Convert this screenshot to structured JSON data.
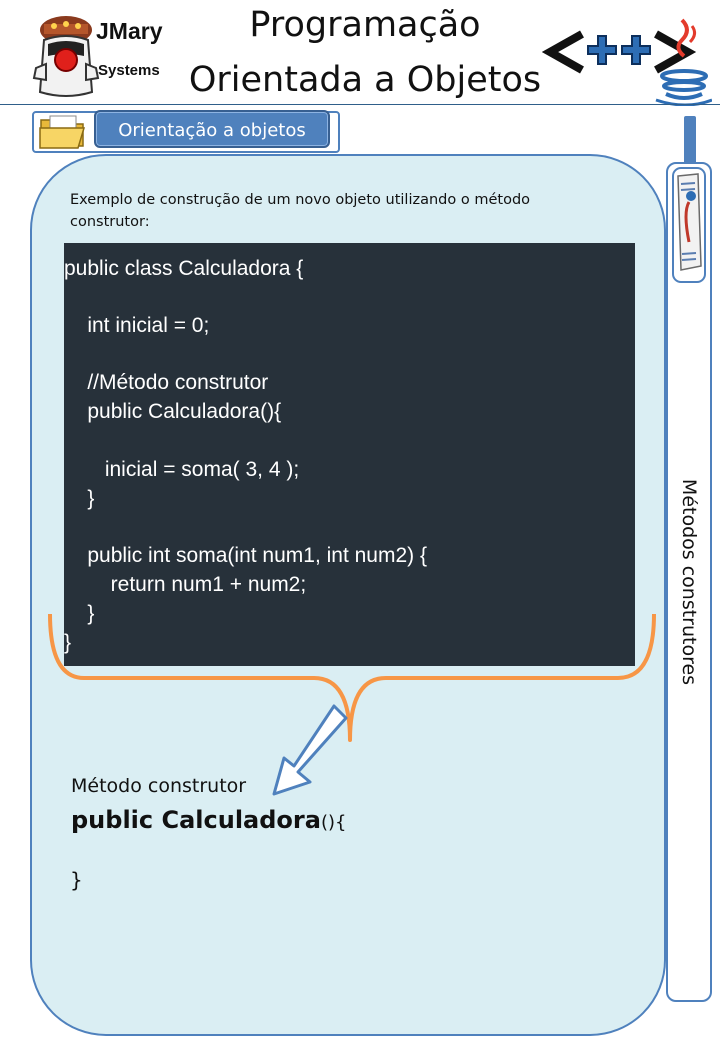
{
  "header": {
    "brand_line1": "JMary",
    "brand_line2": "Systems",
    "title_line1": "Programação",
    "title_line2": "Orientada a Objetos",
    "java_logo_text": "<++>"
  },
  "section_tab": {
    "label": "Orientação a objetos"
  },
  "side_tab": {
    "label": "Métodos construtores"
  },
  "content": {
    "intro_text": "Exemplo de construção de um novo objeto utilizando o método construtor:",
    "code_lines": [
      "public class Calculadora {",
      "",
      "    int inicial = 0;",
      "",
      "    //Método construtor",
      "    public Calculadora(){",
      "",
      "       inicial = soma( 3, 4 );",
      "    }",
      "",
      "    public int soma(int num1, int num2) {",
      "        return num1 + num2;",
      "    }",
      "}"
    ],
    "constructor_label": "Método construtor",
    "signature_bold": "public Calculadora",
    "signature_rest": "(){",
    "closing_brace": "}"
  },
  "colors": {
    "panel_fill": "#daeef3",
    "panel_border": "#4f81bd",
    "code_bg": "#27313a",
    "brace": "#f79646",
    "tab_fill": "#4f81bd"
  },
  "icons": [
    "mascot-logo-icon",
    "java-cup-icon",
    "folder-icon",
    "newspaper-icon",
    "arrow-down-left-icon",
    "curly-brace-icon"
  ]
}
